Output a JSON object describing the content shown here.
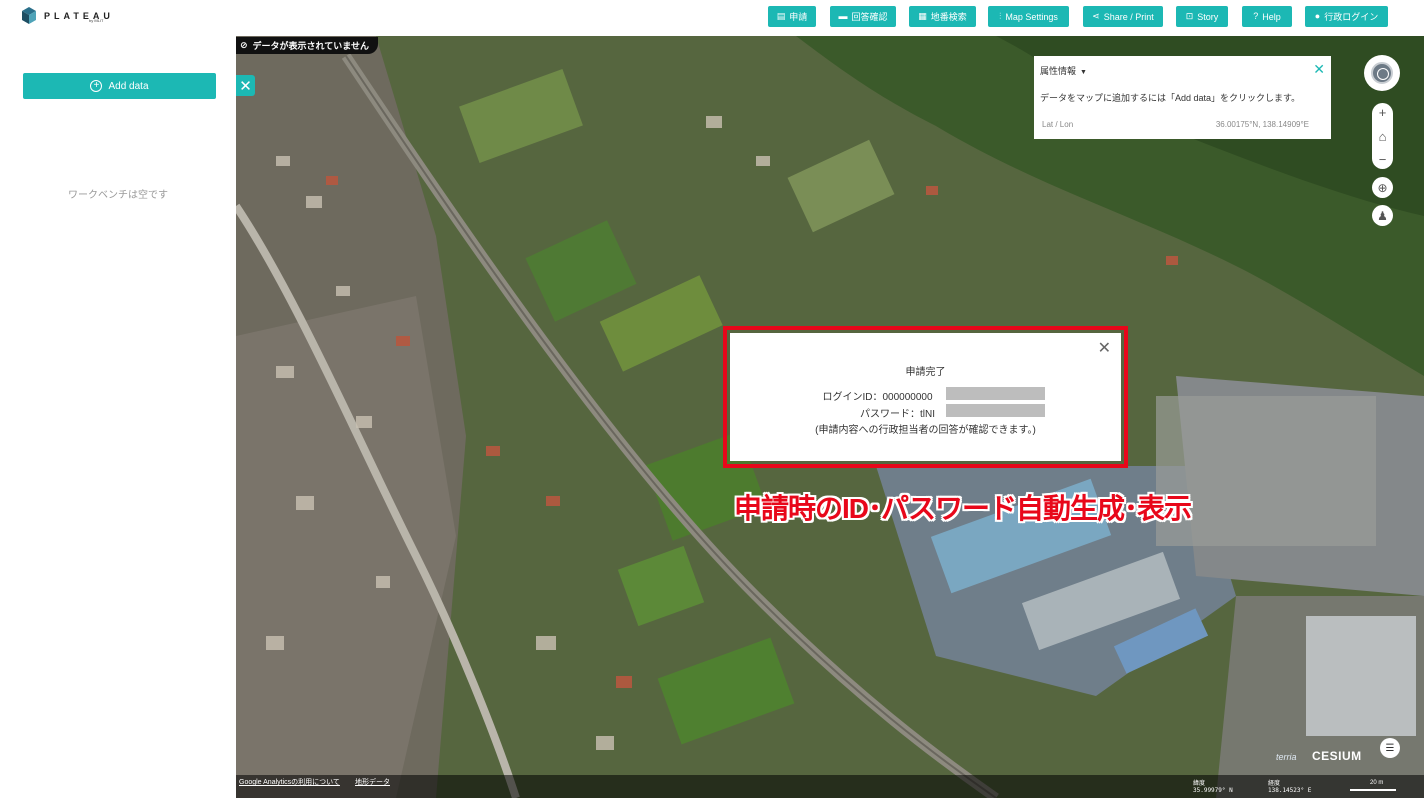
{
  "header": {
    "logo_text": "PLATEAU",
    "logo_sub": "by MLIT",
    "nav": [
      {
        "id": "apply",
        "label": "申請",
        "icon": "document-icon",
        "glyph": "▤"
      },
      {
        "id": "answer",
        "label": "回答確認",
        "icon": "message-icon",
        "glyph": "▬"
      },
      {
        "id": "lot",
        "label": "地番検索",
        "icon": "buildings-icon",
        "glyph": "▦"
      },
      {
        "id": "settings",
        "label": "Map Settings",
        "icon": "sliders-icon",
        "glyph": "⫶"
      },
      {
        "id": "share",
        "label": "Share / Print",
        "icon": "share-icon",
        "glyph": "⋖"
      },
      {
        "id": "story",
        "label": "Story",
        "icon": "story-icon",
        "glyph": "⊡"
      },
      {
        "id": "help",
        "label": "Help",
        "icon": "help-icon",
        "glyph": "?"
      },
      {
        "id": "login",
        "label": "行政ログイン",
        "icon": "user-icon",
        "glyph": "●"
      }
    ]
  },
  "workbench": {
    "add_data_label": "Add data",
    "empty_message": "ワークベンチは空です"
  },
  "map": {
    "no_data_message": "データが表示されていません",
    "close_glyph": "✕"
  },
  "feature_info": {
    "title": "属性情報",
    "caret": "▼",
    "close": "✕",
    "message": "データをマップに追加するには「Add data」をクリックします。",
    "latlon_label": "Lat / Lon",
    "latlon_value": "36.00175°N, 138.14909°E"
  },
  "controls": {
    "zoom_in": "+",
    "home": "⌂",
    "zoom_out": "−",
    "locate": "⊕",
    "pedestrian": "♟"
  },
  "dialog": {
    "close": "✕",
    "title": "申請完了",
    "login_id": "ログインID：000000000",
    "password": "パスワード：tlNI",
    "note": "(申請内容への行政担当者の回答が確認できます。)"
  },
  "annotation": "申請時のID･パスワード自動生成･表示",
  "bottom": {
    "credit_analytics": "Google Analyticsの利用について",
    "credit_terrain": "地形データ",
    "lat_label": "緯度",
    "lat_value": "35.99979° N",
    "lon_label": "経度",
    "lon_value": "138.14523° E",
    "scale": "20 m",
    "cesium": "CESIUM",
    "terria": "terria",
    "feedback_glyph": "☰"
  },
  "colors": {
    "accent": "#1cb8b4",
    "highlight_red": "#e8071a"
  }
}
